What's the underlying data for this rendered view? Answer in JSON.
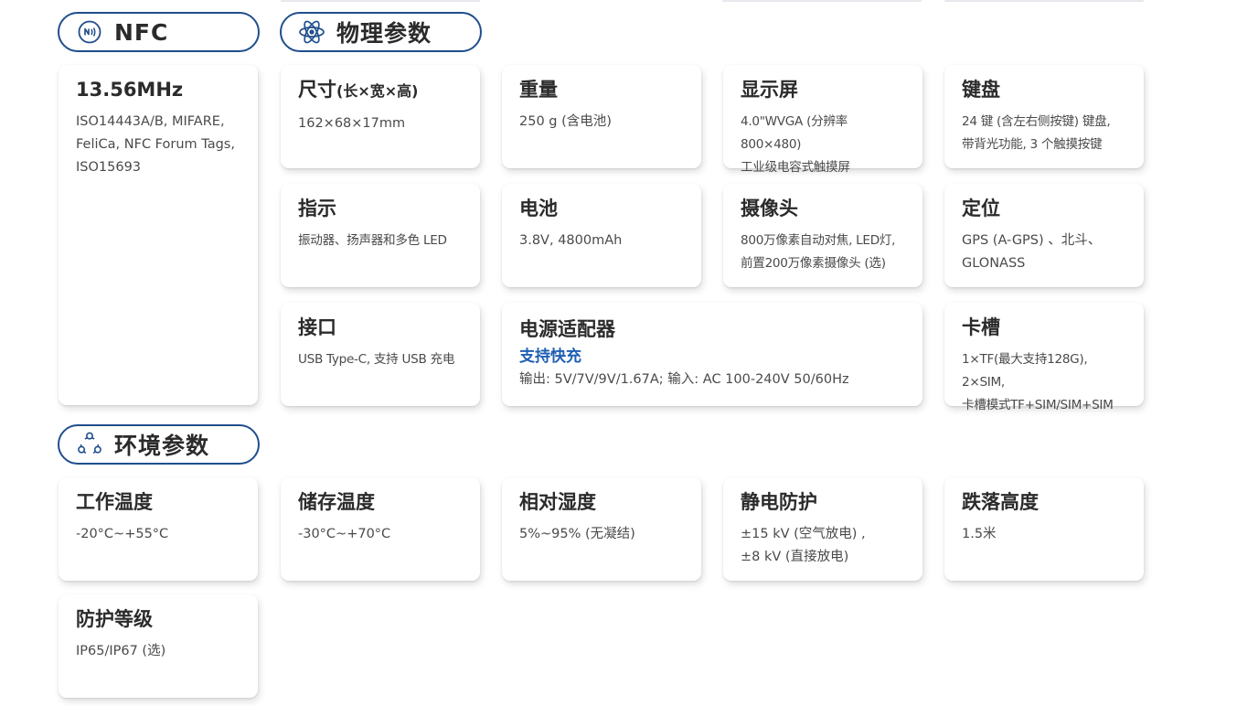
{
  "colors": {
    "accent": "#1f5fb3",
    "pill_border": "#1f4e8c",
    "icon": "#1f4e8c"
  },
  "sections": {
    "nfc": {
      "label": "NFC",
      "icon": "nfc-icon"
    },
    "physical": {
      "label": "物理参数",
      "icon": "atom-icon"
    },
    "environment": {
      "label": "环境参数",
      "icon": "cycle-icon"
    }
  },
  "nfc_card": {
    "title": "13.56MHz",
    "text": "ISO14443A/B, MIFARE,\nFeliCa, NFC Forum Tags,\nISO15693"
  },
  "physical_cards": {
    "size": {
      "title": "尺寸",
      "title_sub": "(长×宽×高)",
      "text": "162×68×17mm"
    },
    "weight": {
      "title": "重量",
      "text": "250 g (含电池)"
    },
    "display": {
      "title": "显示屏",
      "text": "4.0\"WVGA (分辨率 800×480)\n工业级电容式触摸屏"
    },
    "keyboard": {
      "title": "键盘",
      "text": "24 键 (含左右侧按键) 键盘,\n带背光功能, 3 个触摸按键"
    },
    "indicator": {
      "title": "指示",
      "text": "振动器、扬声器和多色 LED"
    },
    "battery": {
      "title": "电池",
      "text": "3.8V, 4800mAh"
    },
    "camera": {
      "title": "摄像头",
      "text": "800万像素自动对焦, LED灯,\n前置200万像素摄像头 (选)"
    },
    "positioning": {
      "title": "定位",
      "text": "GPS (A-GPS) 、北斗、\nGLONASS"
    },
    "interface": {
      "title": "接口",
      "text": "USB Type-C, 支持 USB 充电"
    },
    "adapter": {
      "title": "电源适配器",
      "highlight": "支持快充",
      "text": "输出: 5V/7V/9V/1.67A; 输入: AC 100-240V 50/60Hz"
    },
    "card_slot": {
      "title": "卡槽",
      "text": "1×TF(最大支持128G), 2×SIM,\n卡槽模式TF+SIM/SIM+SIM"
    }
  },
  "environment_cards": {
    "operating_temp": {
      "title": "工作温度",
      "text": "-20°C~+55°C"
    },
    "storage_temp": {
      "title": "储存温度",
      "text": "-30°C~+70°C"
    },
    "humidity": {
      "title": "相对湿度",
      "text": "5%~95% (无凝结)"
    },
    "esd": {
      "title": "静电防护",
      "text": "±15 kV (空气放电) ,\n±8 kV (直接放电)"
    },
    "drop": {
      "title": "跌落高度",
      "text": "1.5米"
    },
    "ip_rating": {
      "title": "防护等级",
      "text": "IP65/IP67 (选)"
    }
  }
}
